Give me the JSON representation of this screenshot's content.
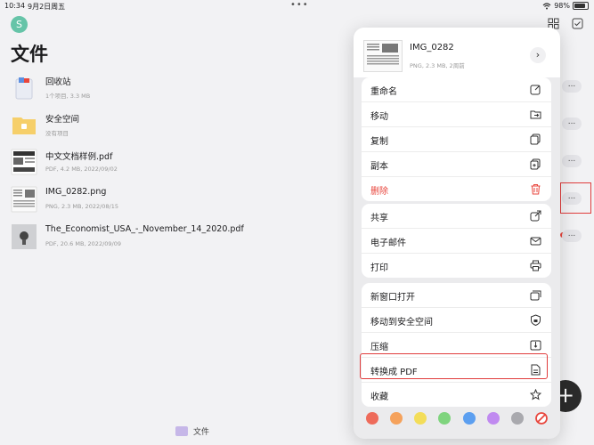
{
  "status": {
    "time": "10:34",
    "date": "9月2日周五",
    "battery": "98%"
  },
  "avatar": {
    "letter": "S"
  },
  "page": {
    "title": "文件"
  },
  "files": [
    {
      "name": "回收站",
      "meta": "1个项目, 3.3 MB"
    },
    {
      "name": "安全空间",
      "meta": "没有项目"
    },
    {
      "name": "中文文档样例.pdf",
      "meta": "PDF, 4.2 MB, 2022/09/02"
    },
    {
      "name": "IMG_0282.png",
      "meta": "PNG, 2.3 MB, 2022/08/15"
    },
    {
      "name": "The_Economist_USA_-_November_14_2020.pdf",
      "meta": "PDF, 20.6 MB, 2022/09/09"
    }
  ],
  "more_label": "...",
  "menu": {
    "file_name": "IMG_0282",
    "file_meta": "PNG, 2.3 MB, 2周前",
    "group1": [
      "重命名",
      "移动",
      "复制",
      "副本",
      "删除"
    ],
    "group2": [
      "共享",
      "电子邮件",
      "打印"
    ],
    "group3": [
      "新窗口打开",
      "移动到安全空间",
      "压缩",
      "转换成 PDF",
      "收藏"
    ],
    "tag_colors": [
      "#ee6b5b",
      "#f5a25c",
      "#f3dd59",
      "#7fd47e",
      "#5c9ff0",
      "#c08af0",
      "#a9a9ae"
    ]
  },
  "bottom_tab": {
    "label": "文件"
  },
  "colors": {
    "danger": "#e8453c",
    "highlight": "#e03c3c",
    "accent": "#66c4a8"
  }
}
